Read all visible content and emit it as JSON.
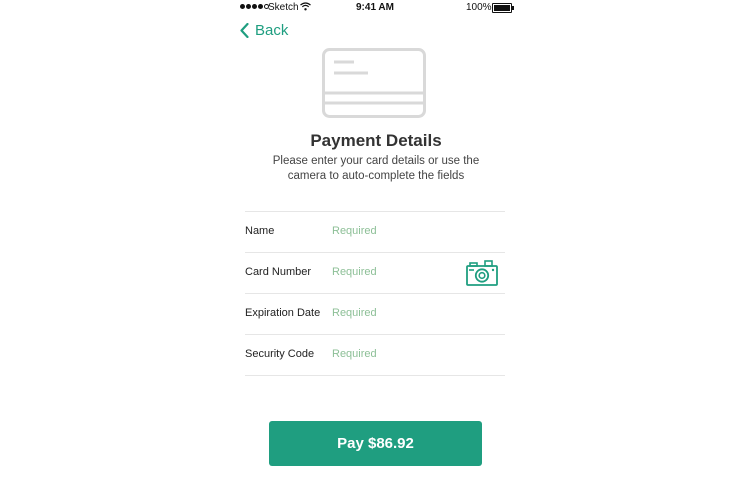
{
  "status_bar": {
    "carrier": "Sketch",
    "time": "9:41 AM",
    "battery_text": "100%",
    "battery_level": 1.0
  },
  "nav": {
    "back_label": "Back",
    "back_icon": "chevron-left-icon"
  },
  "header": {
    "card_icon": "credit-card-icon",
    "title": "Payment Details",
    "subtitle": "Please enter your card details or use the camera to auto-complete the fields"
  },
  "form": {
    "fields": [
      {
        "label": "Name",
        "placeholder": "Required",
        "value": ""
      },
      {
        "label": "Card Number",
        "placeholder": "Required",
        "value": ""
      },
      {
        "label": "Expiration Date",
        "placeholder": "Required",
        "value": ""
      },
      {
        "label": "Security Code",
        "placeholder": "Required",
        "value": ""
      }
    ],
    "camera_icon": "camera-icon"
  },
  "pay_button": {
    "label": "Pay $86.92"
  },
  "colors": {
    "accent": "#1f9e80",
    "placeholder": "#8cbf96",
    "divider": "#e6e6e6"
  }
}
